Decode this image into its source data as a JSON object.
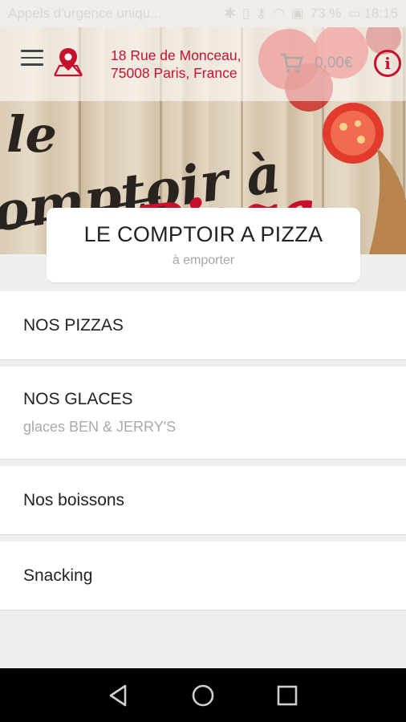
{
  "status_bar": {
    "carrier": "Appels d'urgence uniqu...",
    "battery": "73 %",
    "time": "18:15",
    "icons": [
      "bluetooth-icon",
      "vibrate-icon",
      "key-icon",
      "wifi-icon",
      "sim-icon",
      "battery-icon"
    ]
  },
  "header": {
    "address_line1": "18 Rue de Monceau,",
    "address_line2": "75008 Paris, France",
    "cart_total": "0,00€",
    "info_symbol": "i",
    "icons": [
      "menu-icon",
      "map-pin-icon",
      "cart-icon",
      "info-icon"
    ]
  },
  "hero": {
    "logo_text_1": "le",
    "logo_text_2": "omptoir à",
    "logo_text_3": "Pizza"
  },
  "restaurant": {
    "name": "LE COMPTOIR A PIZZA",
    "mode": "à emporter"
  },
  "categories": [
    {
      "label": "NOS PIZZAS",
      "desc": ""
    },
    {
      "label": "NOS GLACES",
      "desc": "glaces BEN & JERRY'S"
    },
    {
      "label": "Nos boissons",
      "desc": ""
    },
    {
      "label": "Snacking",
      "desc": ""
    }
  ],
  "colors": {
    "accent": "#c8102e",
    "muted": "#a8a8a8",
    "background": "#efefef"
  },
  "nav_bar": {
    "icons": [
      "back-icon",
      "home-icon",
      "recents-icon"
    ]
  }
}
